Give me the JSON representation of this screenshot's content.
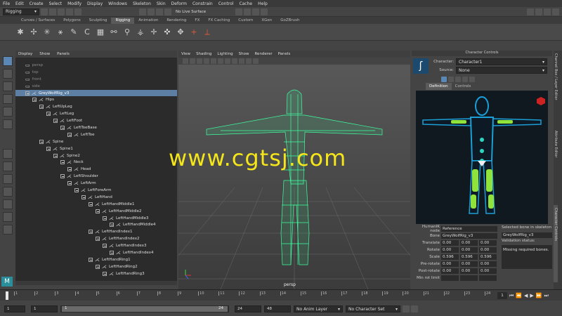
{
  "menu": [
    "File",
    "Edit",
    "Create",
    "Select",
    "Modify",
    "Display",
    "Windows",
    "Skeleton",
    "Skin",
    "Deform",
    "Constrain",
    "Control",
    "Cache",
    "Help"
  ],
  "status": {
    "menuset": "Rigging",
    "live_surface": "No Live Surface"
  },
  "shelf_tabs": [
    "Curves / Surfaces",
    "Polygons",
    "Sculpting",
    "Rigging",
    "Animation",
    "Rendering",
    "FX",
    "FX Caching",
    "Custom",
    "XGen",
    "GoZBrush"
  ],
  "outliner": {
    "menu": [
      "Display",
      "Show",
      "Panels"
    ],
    "rows": [
      {
        "label": "persp",
        "d": 0,
        "dim": true
      },
      {
        "label": "top",
        "d": 0,
        "dim": true
      },
      {
        "label": "front",
        "d": 0,
        "dim": true
      },
      {
        "label": "side",
        "d": 0,
        "dim": true
      },
      {
        "label": "GreyWolfRig_v3",
        "d": 0,
        "sel": true
      },
      {
        "label": "Hips",
        "d": 1
      },
      {
        "label": "LeftUpLeg",
        "d": 2
      },
      {
        "label": "LeftLeg",
        "d": 3
      },
      {
        "label": "LeftFoot",
        "d": 4
      },
      {
        "label": "LeftToeBase",
        "d": 5
      },
      {
        "label": "LeftToe",
        "d": 6
      },
      {
        "label": "Spine",
        "d": 2
      },
      {
        "label": "Spine1",
        "d": 3
      },
      {
        "label": "Spine2",
        "d": 4
      },
      {
        "label": "Neck",
        "d": 5
      },
      {
        "label": "Head",
        "d": 6
      },
      {
        "label": "LeftShoulder",
        "d": 5
      },
      {
        "label": "LeftArm",
        "d": 6
      },
      {
        "label": "LeftForeArm",
        "d": 7
      },
      {
        "label": "LeftHand",
        "d": 8
      },
      {
        "label": "LeftHandMiddle1",
        "d": 9
      },
      {
        "label": "LeftHandMiddle2",
        "d": 10
      },
      {
        "label": "LeftHandMiddle3",
        "d": 11
      },
      {
        "label": "LeftHandMiddle4",
        "d": 12
      },
      {
        "label": "LeftHandIndex1",
        "d": 9
      },
      {
        "label": "LeftHandIndex2",
        "d": 10
      },
      {
        "label": "LeftHandIndex3",
        "d": 11
      },
      {
        "label": "LeftHandIndex4",
        "d": 12
      },
      {
        "label": "LeftHandRing1",
        "d": 9
      },
      {
        "label": "LeftHandRing2",
        "d": 10
      },
      {
        "label": "LeftHandRing3",
        "d": 11
      }
    ]
  },
  "viewport": {
    "menu": [
      "View",
      "Shading",
      "Lighting",
      "Show",
      "Renderer",
      "Panels"
    ],
    "camera": "persp"
  },
  "hik": {
    "title": "Character Controls",
    "character_label": "Character:",
    "character": "Character1",
    "source_label": "Source:",
    "source": "None",
    "tabs": [
      "Definition",
      "Controls"
    ],
    "node_label": "HumanIK node",
    "node_val": "Reference",
    "bone_label": "Bone",
    "bone_val": "GreyWolfRig_v3",
    "selected_header": "Selected bone in skeleton",
    "selected_val": "GreyWolfRig_v3",
    "validation": "Validation status:",
    "missing": "Missing required bones.",
    "props": [
      {
        "l": "Translate",
        "v": [
          "0.00",
          "0.00",
          "0.00"
        ]
      },
      {
        "l": "Rotate",
        "v": [
          "0.00",
          "0.00",
          "0.00"
        ]
      },
      {
        "l": "Scale",
        "v": [
          "0.596",
          "0.596",
          "0.596"
        ]
      },
      {
        "l": "Pre-rotate",
        "v": [
          "0.00",
          "0.00",
          "0.00"
        ]
      },
      {
        "l": "Post-rotate",
        "v": [
          "0.00",
          "0.00",
          "0.00"
        ]
      },
      {
        "l": "Min rot limit",
        "v": [
          "",
          "",
          ""
        ]
      }
    ]
  },
  "sidetabs": [
    "Channel Box / Layer Editor",
    "Attribute Editor",
    "Character Controls"
  ],
  "timeline": {
    "ticks": [
      "1",
      "2",
      "3",
      "4",
      "5",
      "6",
      "7",
      "8",
      "9",
      "10",
      "11",
      "12",
      "13",
      "14",
      "15",
      "16",
      "17",
      "18",
      "19",
      "20",
      "21",
      "22",
      "23",
      "24"
    ],
    "current": "1"
  },
  "range": {
    "start": "1",
    "start2": "1",
    "slider_start": "1",
    "slider_end": "24",
    "end": "24",
    "end2": "48",
    "anim_layer": "No Anim Layer",
    "char_set": "No Character Set"
  },
  "watermark": "www.cgtsj.com",
  "colors": {
    "mesh": "#3dffa0",
    "select": "#5d7fa3",
    "body": "#1a9fd6",
    "limb": "#8fe33a",
    "effector": "#cc2222"
  }
}
